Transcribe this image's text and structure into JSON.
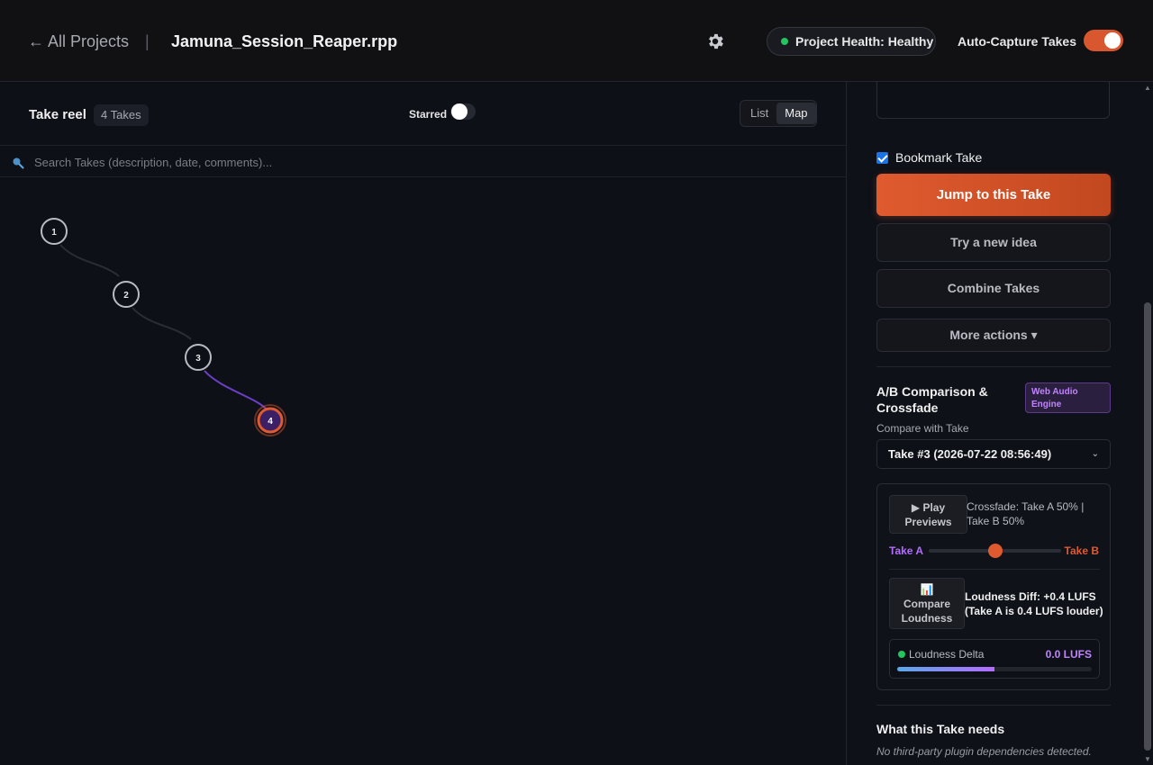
{
  "header": {
    "back_label": "← All Projects",
    "separator": "|",
    "project_title": "Jamuna_Session_Reaper.rpp",
    "health_label": "Project Health: Healthy",
    "health_color": "#22c55e",
    "autocapture_label": "Auto-Capture Takes",
    "autocapture_on": true
  },
  "reel": {
    "title": "Take reel",
    "count_label": "4 Takes",
    "starred_label": "Starred",
    "starred_on": false,
    "view_options": [
      "List",
      "Map"
    ],
    "active_view": "Map"
  },
  "search": {
    "placeholder": "Search Takes (description, date, comments)..."
  },
  "take_map": {
    "nodes": [
      {
        "label": "1",
        "selected": false
      },
      {
        "label": "2",
        "selected": false
      },
      {
        "label": "3",
        "selected": false
      },
      {
        "label": "4",
        "selected": true
      }
    ],
    "accent_color": "#e05a2f",
    "path_color": "#6d3fc7"
  },
  "sidebar": {
    "bookmark_label": "Bookmark Take",
    "bookmark_checked": true,
    "jump_label": "Jump to this Take",
    "try_label": "Try a new idea",
    "combine_label": "Combine Takes",
    "more_label": "More actions ▾",
    "ab_title": "A/B Comparison & Crossfade",
    "engine_badge": "Web Audio Engine",
    "compare_label": "Compare with Take",
    "compare_selected": "Take #3 (2026-07-22 08:56:49)",
    "play_label": "▶ Play Previews",
    "crossfade_text": "Crossfade: Take A 50% | Take B 50%",
    "take_a_label": "Take A",
    "take_b_label": "Take B",
    "crossfade_value": 0.5,
    "loudness_btn_icon": "📊",
    "loudness_btn_label": "Compare Loudness",
    "loudness_diff": "Loudness Diff: +0.4 LUFS (Take A is 0.4 LUFS louder)",
    "delta_label": "Loudness Delta",
    "delta_value": "0.0 LUFS",
    "delta_fill": 0.5,
    "needs_title": "What this Take needs",
    "needs_text": "No third-party plugin dependencies detected."
  }
}
